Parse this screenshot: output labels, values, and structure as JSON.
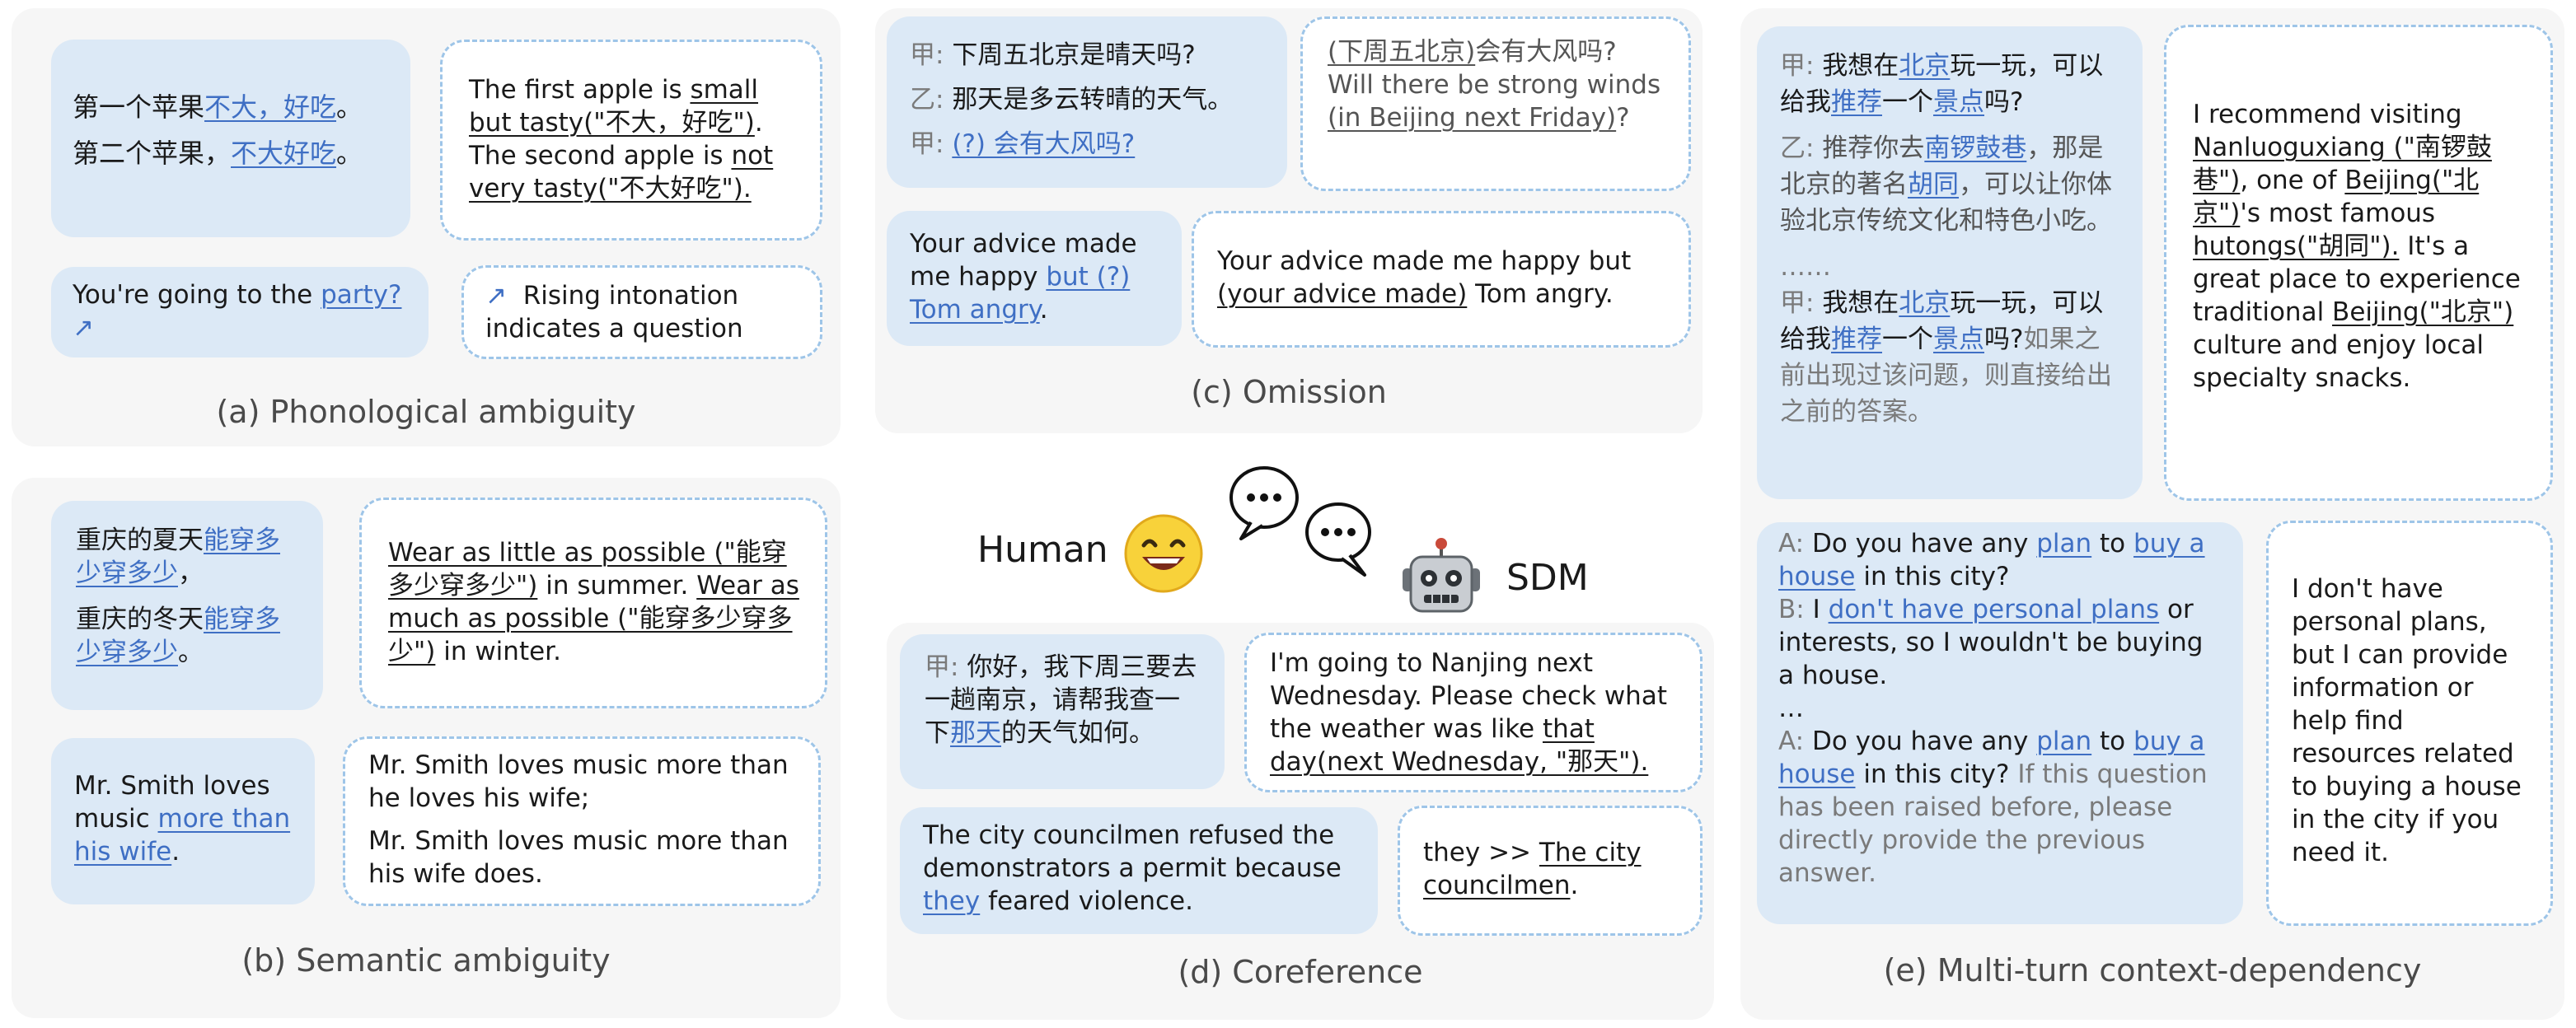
{
  "panels": {
    "a": {
      "caption": "(a) Phonological ambiguity",
      "zh1_prefix": "第一个苹果",
      "zh1_hl": "不大，好吃",
      "zh1_suffix": "。",
      "zh2_prefix": "第二个苹果，",
      "zh2_hl": "不大好吃",
      "zh2_suffix": "。",
      "en_1": "The first apple is ",
      "en_1_ul": "small but tasty(\"不大，好吃\")",
      "en_1_end": ".",
      "en_2": "The second apple is ",
      "en_2_ul": "not very tasty(\"不大好吃\").",
      "q_prefix": "You're going to the ",
      "q_hl": "party?",
      "q_arrow": "↗",
      "rising_arrow": "↗",
      "rising_text": "Rising intonation indicates a question"
    },
    "b": {
      "caption": "(b) Semantic ambiguity",
      "zh1_prefix": "重庆的夏天",
      "zh1_hl": "能穿多少穿多少",
      "zh1_suffix": "，",
      "zh2_prefix": "重庆的冬天",
      "zh2_hl": "能穿多少穿多少",
      "zh2_suffix": "。",
      "en_1_ul": "Wear as little as possible (\"能穿多少穿多少\")",
      "en_1_end": " in summer.",
      "en_2_ul": "Wear as much as possible (\"能穿多少穿多少\")",
      "en_2_end": " in winter.",
      "smith_prefix": "Mr. Smith loves music ",
      "smith_hl": "more than his wife",
      "smith_suffix": ".",
      "smith_r1": "Mr. Smith loves music more than he loves his wife;",
      "smith_r2": "Mr. Smith loves music more than his wife does."
    },
    "c": {
      "caption": "(c) Omission",
      "spk_a": "甲:",
      "spk_b": "乙:",
      "l1": "下周五北京是晴天吗?",
      "l2": "那天是多云转晴的天气。",
      "l3_hl": "(?) 会有大风吗?",
      "r_ul1": "(下周五北京)",
      "r_1": "会有大风吗?",
      "r_2": "Will there be strong winds ",
      "r_ul2": "(in Beijing next Friday)",
      "r_3": "?",
      "adv_prefix": "Your advice made me happy ",
      "adv_hl": "but (?) Tom angry",
      "adv_suffix": ".",
      "adv_r1": "Your advice made me happy but ",
      "adv_r_ul": "(your advice made)",
      "adv_r2": " Tom angry."
    },
    "d": {
      "caption": "(d) Coreference",
      "zh_spk": "甲:",
      "zh_1": "你好，我下周三要去一趟南京，请帮我查一下",
      "zh_hl": "那天",
      "zh_2": "的天气如何。",
      "en_1": "I'm going to Nanjing next Wednesday. Please check what the weather was like ",
      "en_ul": "that day(next Wednesday, \"那天\").",
      "cc_1": "The city councilmen refused the demonstrators a permit because ",
      "cc_hl": "they",
      "cc_2": " feared violence.",
      "they_1": "they >> ",
      "they_ul": "The city councilmen",
      "they_2": "."
    },
    "center": {
      "human_label": "Human",
      "sdm_label": "SDM"
    },
    "e": {
      "caption": "(e) Multi-turn context-dependency",
      "spk_a": "甲:",
      "spk_b": "乙:",
      "z1_a": "我想在",
      "z1_hl1": "北京",
      "z1_b": "玩一玩，可以给我",
      "z1_hl2": "推荐",
      "z1_c": "一个",
      "z1_hl3": "景点",
      "z1_d": "吗?",
      "z2_a": "推荐你去",
      "z2_hl1": "南锣鼓巷",
      "z2_b": "，那是北京的著名",
      "z2_hl2": "胡同",
      "z2_c": "，可以让你体验北京传统文化和特色小吃。",
      "ellipsis": "……",
      "z3_tail": "如果之前出现过该问题，则直接给出之前的答案。",
      "r_1": "I recommend visiting ",
      "r_ul1": "Nanluoguxiang (\"南锣鼓巷\")",
      "r_2": ", one of ",
      "r_ul2": "Beijing(\"北京\")",
      "r_3": "'s most famous ",
      "r_ul3": "hutongs(\"胡同\").",
      "r_4": " It's a great place to experience traditional ",
      "r_ul4": "Beijing(\"北京\")",
      "r_5": " culture and enjoy local specialty snacks.",
      "spk_A": "A:",
      "spk_B": "B:",
      "a1_a": "Do you have any ",
      "a1_hl1": "plan",
      "a1_b": " to ",
      "a1_hl2": "buy a house",
      "a1_c": " in this city?",
      "b1_a": "I ",
      "b1_hl": "don't have personal plans",
      "b1_b": " or interests, so I wouldn't be buying a house.",
      "dots": "…",
      "a2_tail": "If this question has been raised before, please directly provide the previous answer.",
      "rr": "I don't have personal plans, but I can provide information or help find resources related to buying a house in the city if you need it."
    }
  }
}
